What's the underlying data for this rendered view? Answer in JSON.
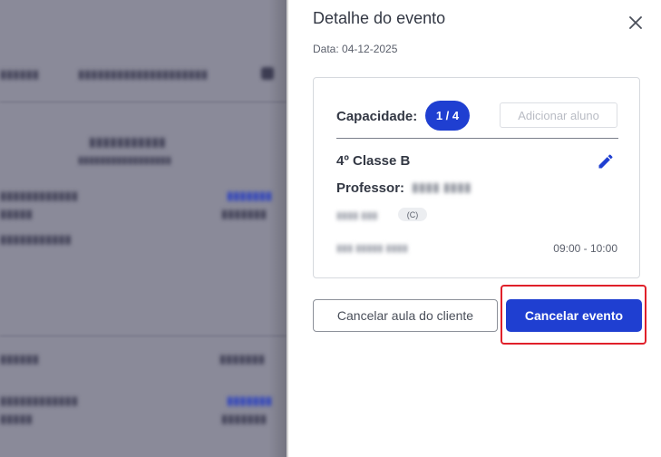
{
  "drawer": {
    "title": "Detalhe do evento",
    "date": "Data: 04-12-2025",
    "close_icon": "close-icon"
  },
  "card": {
    "capacity_label": "Capacidade:",
    "capacity_value": "1 / 4",
    "add_student_label": "Adicionar aluno",
    "class_name": "4º Classe B",
    "edit_icon": "pencil-icon",
    "professor_label": "Professor:",
    "type_chip": "(C)",
    "time_range": "09:00 - 10:00"
  },
  "actions": {
    "cancel_class_label": "Cancelar aula do cliente",
    "cancel_event_label": "Cancelar evento"
  },
  "colors": {
    "primary": "#1f3fd1",
    "highlight": "#e0202a",
    "backdrop": "#8a8a99"
  }
}
